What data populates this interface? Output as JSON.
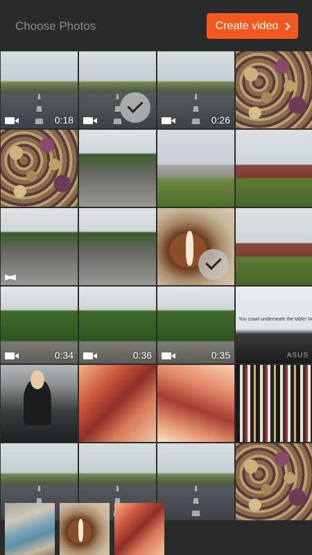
{
  "header": {
    "title": "Choose Photos",
    "create_label": "Create video"
  },
  "tiles": [
    {
      "type": "video",
      "img": "road",
      "duration": "0:18",
      "selected": false
    },
    {
      "type": "video",
      "img": "road",
      "duration": "",
      "selected": true
    },
    {
      "type": "video",
      "img": "road",
      "duration": "0:26",
      "selected": false
    },
    {
      "type": "photo",
      "img": "beans",
      "selected": false
    },
    {
      "type": "photo",
      "img": "beans",
      "selected": false
    },
    {
      "type": "photo",
      "img": "parking",
      "selected": false
    },
    {
      "type": "photo",
      "img": "school",
      "selected": false
    },
    {
      "type": "photo",
      "img": "bldg",
      "selected": false
    },
    {
      "type": "pano",
      "img": "parking",
      "selected": false
    },
    {
      "type": "photo",
      "img": "parking",
      "selected": false
    },
    {
      "type": "photo",
      "img": "horse",
      "selected": true
    },
    {
      "type": "photo",
      "img": "bldg",
      "selected": false
    },
    {
      "type": "video",
      "img": "trees",
      "duration": "0:34",
      "selected": false
    },
    {
      "type": "video",
      "img": "trees",
      "duration": "0:36",
      "selected": false
    },
    {
      "type": "video",
      "img": "trees",
      "duration": "0:35",
      "selected": false
    },
    {
      "type": "photo",
      "img": "screen",
      "selected": false,
      "text": "You crawl underneath the table! No one will see you.",
      "brand": "ASUS"
    },
    {
      "type": "photo",
      "img": "lib",
      "selected": false
    },
    {
      "type": "photo",
      "img": "canyon",
      "selected": false
    },
    {
      "type": "photo",
      "img": "canyon2",
      "selected": false
    },
    {
      "type": "photo",
      "img": "books",
      "selected": false
    },
    {
      "type": "photo",
      "img": "road",
      "selected": false
    },
    {
      "type": "photo",
      "img": "road",
      "selected": false
    },
    {
      "type": "photo",
      "img": "road",
      "selected": false
    },
    {
      "type": "photo",
      "img": "beans",
      "selected": false
    }
  ],
  "last_row": [
    {
      "img": "shore"
    },
    {
      "img": "horse"
    },
    {
      "img": "canyon"
    }
  ]
}
